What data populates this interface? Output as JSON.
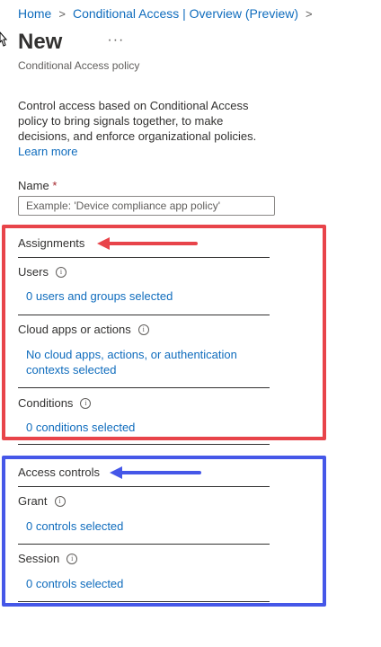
{
  "breadcrumb": {
    "items": [
      "Home",
      "Conditional Access | Overview (Preview)"
    ],
    "separator": ">"
  },
  "header": {
    "title": "New",
    "more": "···",
    "subtitle": "Conditional Access policy"
  },
  "intro": {
    "description": "Control access based on Conditional Access policy to bring signals together, to make decisions, and enforce organizational policies.",
    "learn_more": "Learn more"
  },
  "name_field": {
    "label": "Name",
    "required_marker": "*",
    "placeholder": "Example: 'Device compliance app policy'",
    "value": ""
  },
  "assignments": {
    "title": "Assignments",
    "users": {
      "label": "Users",
      "link": "0 users and groups selected"
    },
    "cloud_apps": {
      "label": "Cloud apps or actions",
      "link": "No cloud apps, actions, or authentication contexts selected"
    },
    "conditions": {
      "label": "Conditions",
      "link": "0 conditions selected"
    }
  },
  "access_controls": {
    "title": "Access controls",
    "grant": {
      "label": "Grant",
      "link": "0 controls selected"
    },
    "session": {
      "label": "Session",
      "link": "0 controls selected"
    }
  },
  "icons": {
    "info": "info-icon",
    "chevron": "chevron-right-icon",
    "more": "more-icon",
    "cursor": "cursor-icon"
  },
  "colors": {
    "link": "#0f6cbd",
    "required": "#a4262c",
    "annotation_red": "#e8444a",
    "annotation_blue": "#4557e8"
  }
}
